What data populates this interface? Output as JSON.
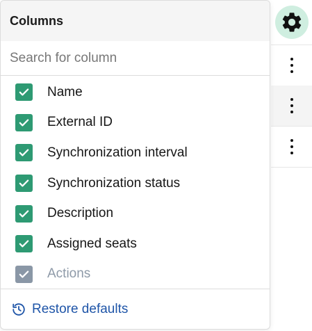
{
  "panel": {
    "title": "Columns",
    "search": {
      "placeholder": "Search for column",
      "value": ""
    },
    "columns": [
      {
        "label": "Name",
        "checked": true,
        "disabled": false
      },
      {
        "label": "External ID",
        "checked": true,
        "disabled": false
      },
      {
        "label": "Synchronization interval",
        "checked": true,
        "disabled": false
      },
      {
        "label": "Synchronization status",
        "checked": true,
        "disabled": false
      },
      {
        "label": "Description",
        "checked": true,
        "disabled": false
      },
      {
        "label": "Assigned seats",
        "checked": true,
        "disabled": false
      },
      {
        "label": "Actions",
        "checked": true,
        "disabled": true
      }
    ],
    "restore_label": "Restore defaults"
  },
  "icons": {
    "settings": "gear-icon",
    "row_menu": "kebab-menu-icon",
    "checkbox": "check-icon",
    "restore": "history-icon"
  },
  "colors": {
    "checkbox_checked": "#2e9a73",
    "checkbox_disabled": "#8a97a6",
    "link": "#1f55a8",
    "gear_button_bg": "#cfeee0"
  }
}
